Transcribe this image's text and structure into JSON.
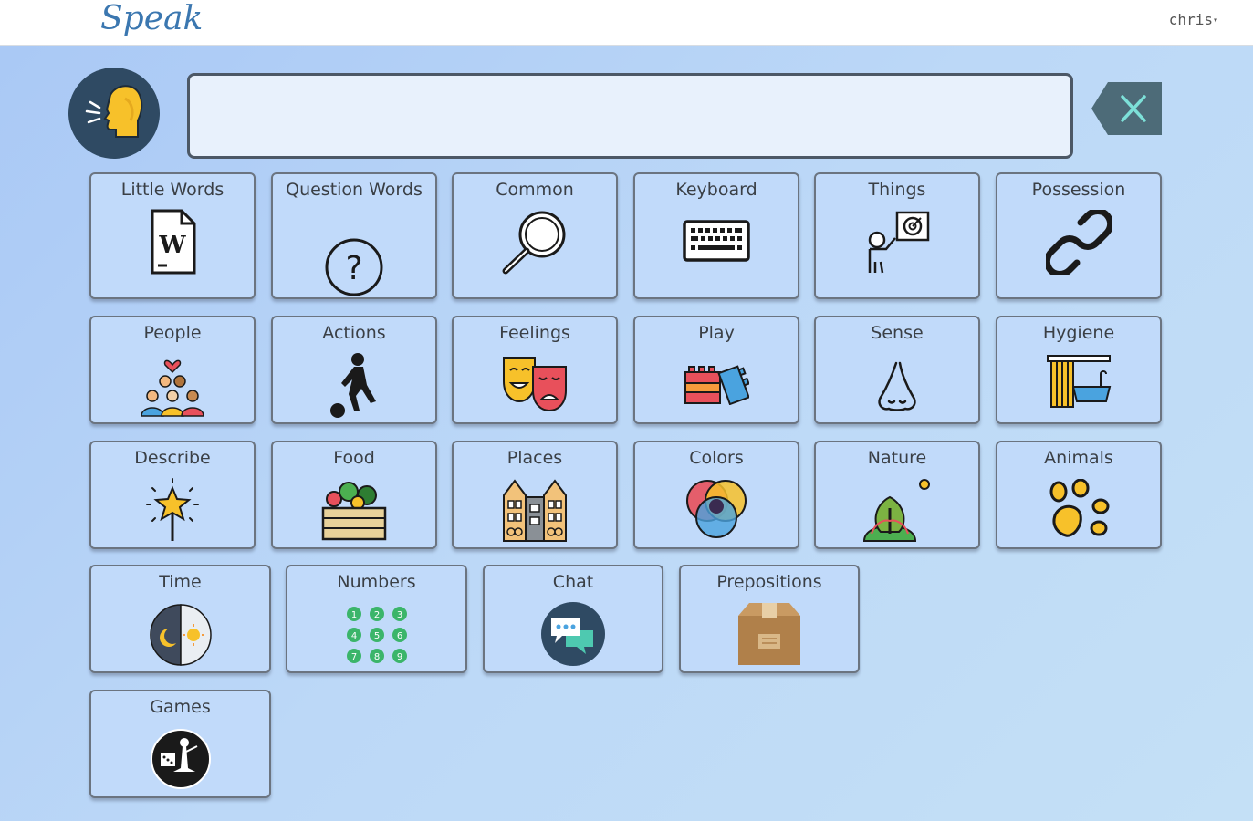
{
  "app": {
    "logo": "Speak",
    "user": "chris"
  },
  "message_bar": {
    "value": ""
  },
  "icons": {
    "speaker": "speaking-head-icon",
    "clear": "clear-x-icon"
  },
  "colors": {
    "dark_navy": "#2f4a63",
    "accent_yellow": "#f7c12a",
    "clear_button": "#4d6b78",
    "tile_bg": "#c1dafa"
  },
  "tiles": [
    {
      "label": "Little Words",
      "icon": "word-document-icon"
    },
    {
      "label": "Question Words",
      "icon": "question-mark-icon"
    },
    {
      "label": "Common",
      "icon": "magnifier-icon"
    },
    {
      "label": "Keyboard",
      "icon": "keyboard-icon"
    },
    {
      "label": "Things",
      "icon": "pointing-teacher-icon"
    },
    {
      "label": "Possession",
      "icon": "chain-link-icon"
    },
    {
      "label": "People",
      "icon": "people-group-icon"
    },
    {
      "label": "Actions",
      "icon": "kicking-ball-icon"
    },
    {
      "label": "Feelings",
      "icon": "theater-masks-icon"
    },
    {
      "label": "Play",
      "icon": "toy-blocks-icon"
    },
    {
      "label": "Sense",
      "icon": "nose-icon"
    },
    {
      "label": "Hygiene",
      "icon": "bathtub-icon"
    },
    {
      "label": "Describe",
      "icon": "star-wand-icon"
    },
    {
      "label": "Food",
      "icon": "vegetable-crate-icon"
    },
    {
      "label": "Places",
      "icon": "buildings-icon"
    },
    {
      "label": "Colors",
      "icon": "color-circles-icon"
    },
    {
      "label": "Nature",
      "icon": "tree-hill-icon"
    },
    {
      "label": "Animals",
      "icon": "paw-print-icon"
    },
    {
      "label": "Time",
      "icon": "day-night-icon"
    },
    {
      "label": "Numbers",
      "icon": "number-grid-icon",
      "digits": [
        "1",
        "2",
        "3",
        "4",
        "5",
        "6",
        "7",
        "8",
        "9"
      ]
    },
    {
      "label": "Chat",
      "icon": "chat-bubbles-icon"
    },
    {
      "label": "Prepositions",
      "icon": "cardboard-box-icon"
    },
    {
      "label": "Games",
      "icon": "board-games-icon"
    }
  ]
}
